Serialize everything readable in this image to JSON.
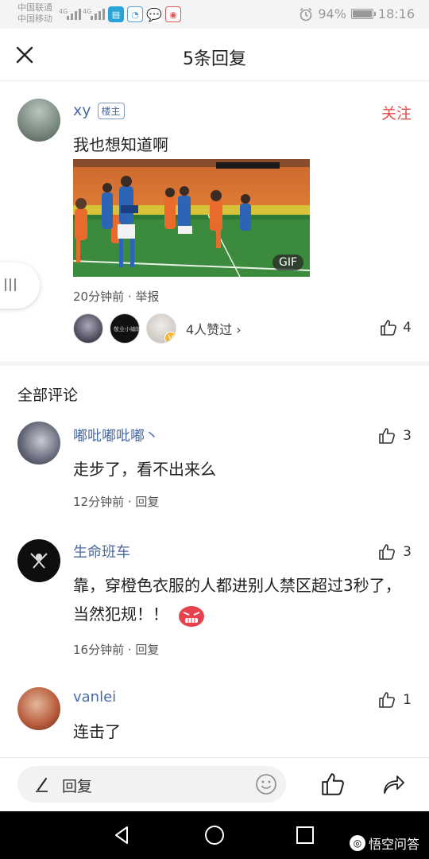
{
  "status_bar": {
    "carrier_1": "中国联通",
    "carrier_2": "中国移动",
    "network_1": "4G",
    "network_2": "4G",
    "battery": "94%",
    "battery_level": 0.94,
    "time": "18:16"
  },
  "header": {
    "title": "5条回复"
  },
  "post": {
    "username": "xy",
    "owner_badge": "楼主",
    "follow_label": "关注",
    "text": "我也想知道啊",
    "gif_label": "GIF",
    "meta": "20分钟前 · 举报",
    "likers_text": "4人赞过 ›",
    "like_count": "4",
    "liker_avatar_text": "敬业小编辑"
  },
  "section": {
    "all_comments": "全部评论"
  },
  "comments": [
    {
      "name": "嘟吡嘟吡嘟丶",
      "text": "走步了，看不出来么",
      "meta": "12分钟前 · 回复",
      "likes": "3"
    },
    {
      "name": "生命班车",
      "text": "靠，穿橙色衣服的人都进别人禁区超过3秒了，当然犯规！！",
      "meta": "16分钟前 · 回复",
      "likes": "3"
    },
    {
      "name": "vanlei",
      "text": "连击了",
      "meta": "",
      "likes": "1"
    }
  ],
  "bottom_bar": {
    "reply_placeholder": "回复"
  },
  "watermark": {
    "text": "悟空问答"
  },
  "colors": {
    "accent_blue": "#4a6aa0",
    "follow_red": "#e74c4c"
  }
}
